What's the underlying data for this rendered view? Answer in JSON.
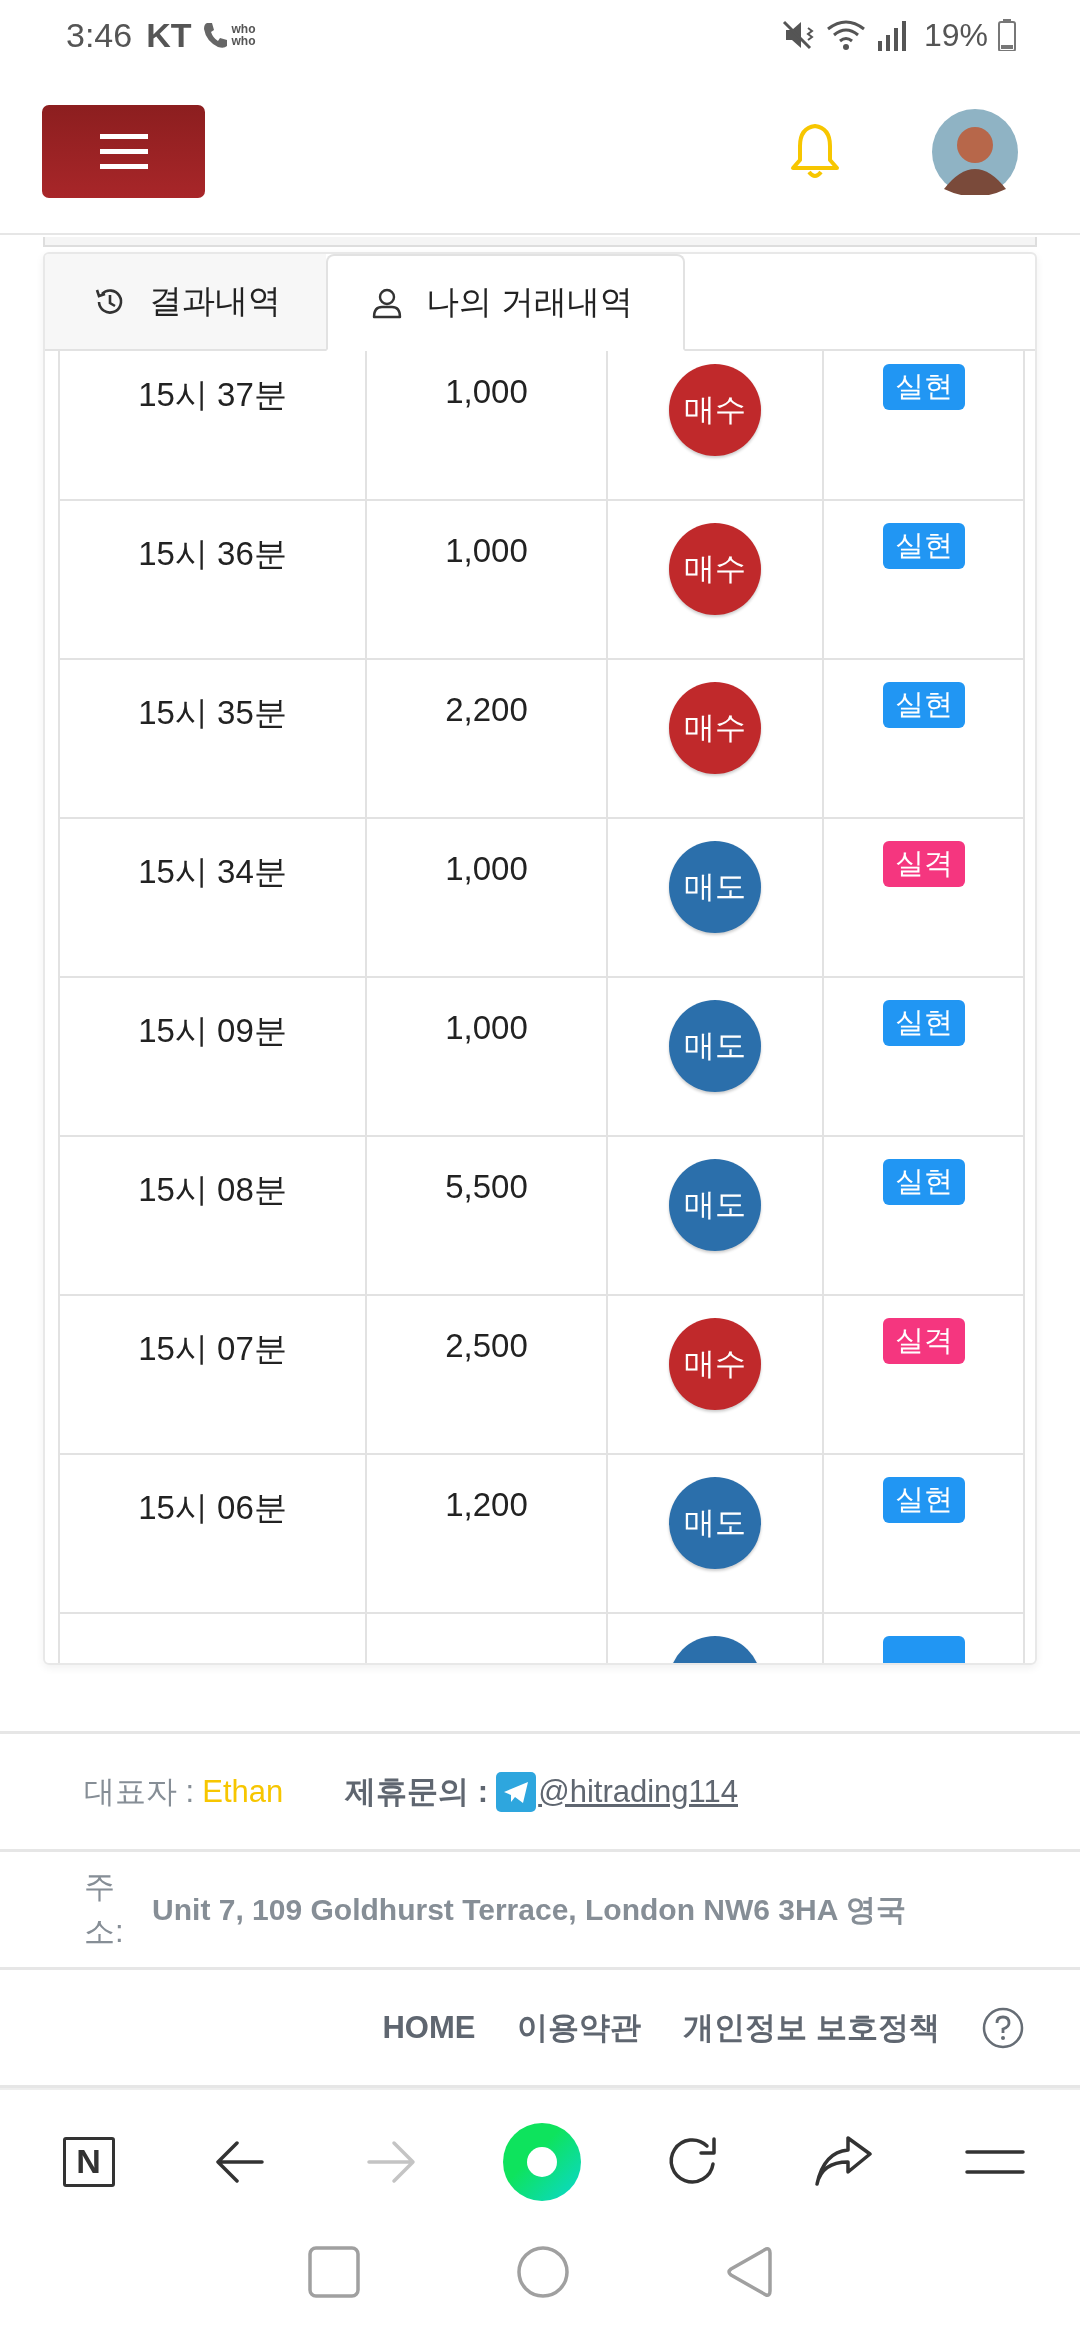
{
  "status_bar": {
    "time": "3:46",
    "carrier": "KT",
    "call_app_label": [
      "who",
      "who"
    ],
    "battery": "19%"
  },
  "tabs": [
    {
      "label": "결과내역",
      "kind": "history",
      "selected": false
    },
    {
      "label": "나의 거래내역",
      "kind": "user",
      "selected": true
    }
  ],
  "trades": [
    {
      "time": "15시 37분",
      "amount": "1,000",
      "side": {
        "label": "매수",
        "kind": "buy"
      },
      "result": {
        "label": "실현",
        "kind": "win"
      }
    },
    {
      "time": "15시 36분",
      "amount": "1,000",
      "side": {
        "label": "매수",
        "kind": "buy"
      },
      "result": {
        "label": "실현",
        "kind": "win"
      }
    },
    {
      "time": "15시 35분",
      "amount": "2,200",
      "side": {
        "label": "매수",
        "kind": "buy"
      },
      "result": {
        "label": "실현",
        "kind": "win"
      }
    },
    {
      "time": "15시 34분",
      "amount": "1,000",
      "side": {
        "label": "매도",
        "kind": "sell"
      },
      "result": {
        "label": "실격",
        "kind": "loss"
      }
    },
    {
      "time": "15시 09분",
      "amount": "1,000",
      "side": {
        "label": "매도",
        "kind": "sell"
      },
      "result": {
        "label": "실현",
        "kind": "win"
      }
    },
    {
      "time": "15시 08분",
      "amount": "5,500",
      "side": {
        "label": "매도",
        "kind": "sell"
      },
      "result": {
        "label": "실현",
        "kind": "win"
      }
    },
    {
      "time": "15시 07분",
      "amount": "2,500",
      "side": {
        "label": "매수",
        "kind": "buy"
      },
      "result": {
        "label": "실격",
        "kind": "loss"
      }
    },
    {
      "time": "15시 06분",
      "amount": "1,200",
      "side": {
        "label": "매도",
        "kind": "sell"
      },
      "result": {
        "label": "실현",
        "kind": "win"
      }
    },
    {
      "side": {
        "kind": "sell"
      },
      "result": {
        "kind": "win"
      }
    }
  ],
  "footer": {
    "ceo_label": "대표자 :",
    "ceo_name": "Ethan",
    "contact_label": "제휴문의 :",
    "contact_link": "@hitrading114",
    "address_label": "주소:",
    "address": "Unit 7, 109 Goldhurst Terrace, London NW6 3HA 영국",
    "links": [
      "HOME",
      "이용약관",
      "개인정보 보호정책"
    ]
  },
  "browser_bar": {
    "logo_letter": "N",
    "forward_disabled": true
  }
}
